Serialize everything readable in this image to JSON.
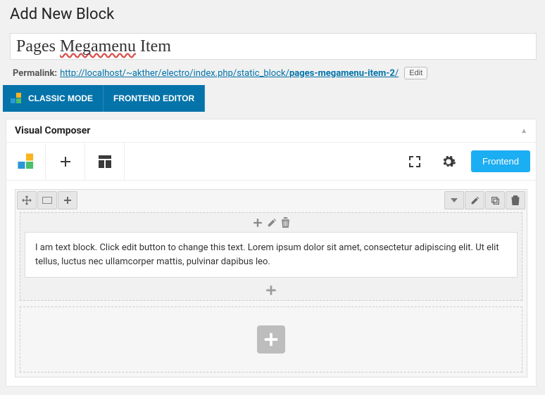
{
  "page_title": "Add New Block",
  "post_title_before": "Pages ",
  "post_title_spellerr": "Megamenu",
  "post_title_after": " Item",
  "permalink": {
    "label": "Permalink:",
    "base": "http://localhost/~akther/electro/index.php/static_block/",
    "slug": "pages-megamenu-item-2",
    "trail": "/",
    "edit_label": "Edit",
    "full": "http://localhost/~akther/electro/index.php/static_block/pages-megamenu-item-2/"
  },
  "tabs": {
    "classic": "CLASSIC MODE",
    "frontend": "FRONTEND EDITOR"
  },
  "panel": {
    "title": "Visual Composer",
    "frontend_btn": "Frontend"
  },
  "content": {
    "text_block": "I am text block. Click edit button to change this text. Lorem ipsum dolor sit amet, consectetur adipiscing elit. Ut elit tellus, luctus nec ullamcorper mattis, pulvinar dapibus leo."
  },
  "colors": {
    "primary": "#0473aa",
    "frontend": "#1caef2"
  }
}
